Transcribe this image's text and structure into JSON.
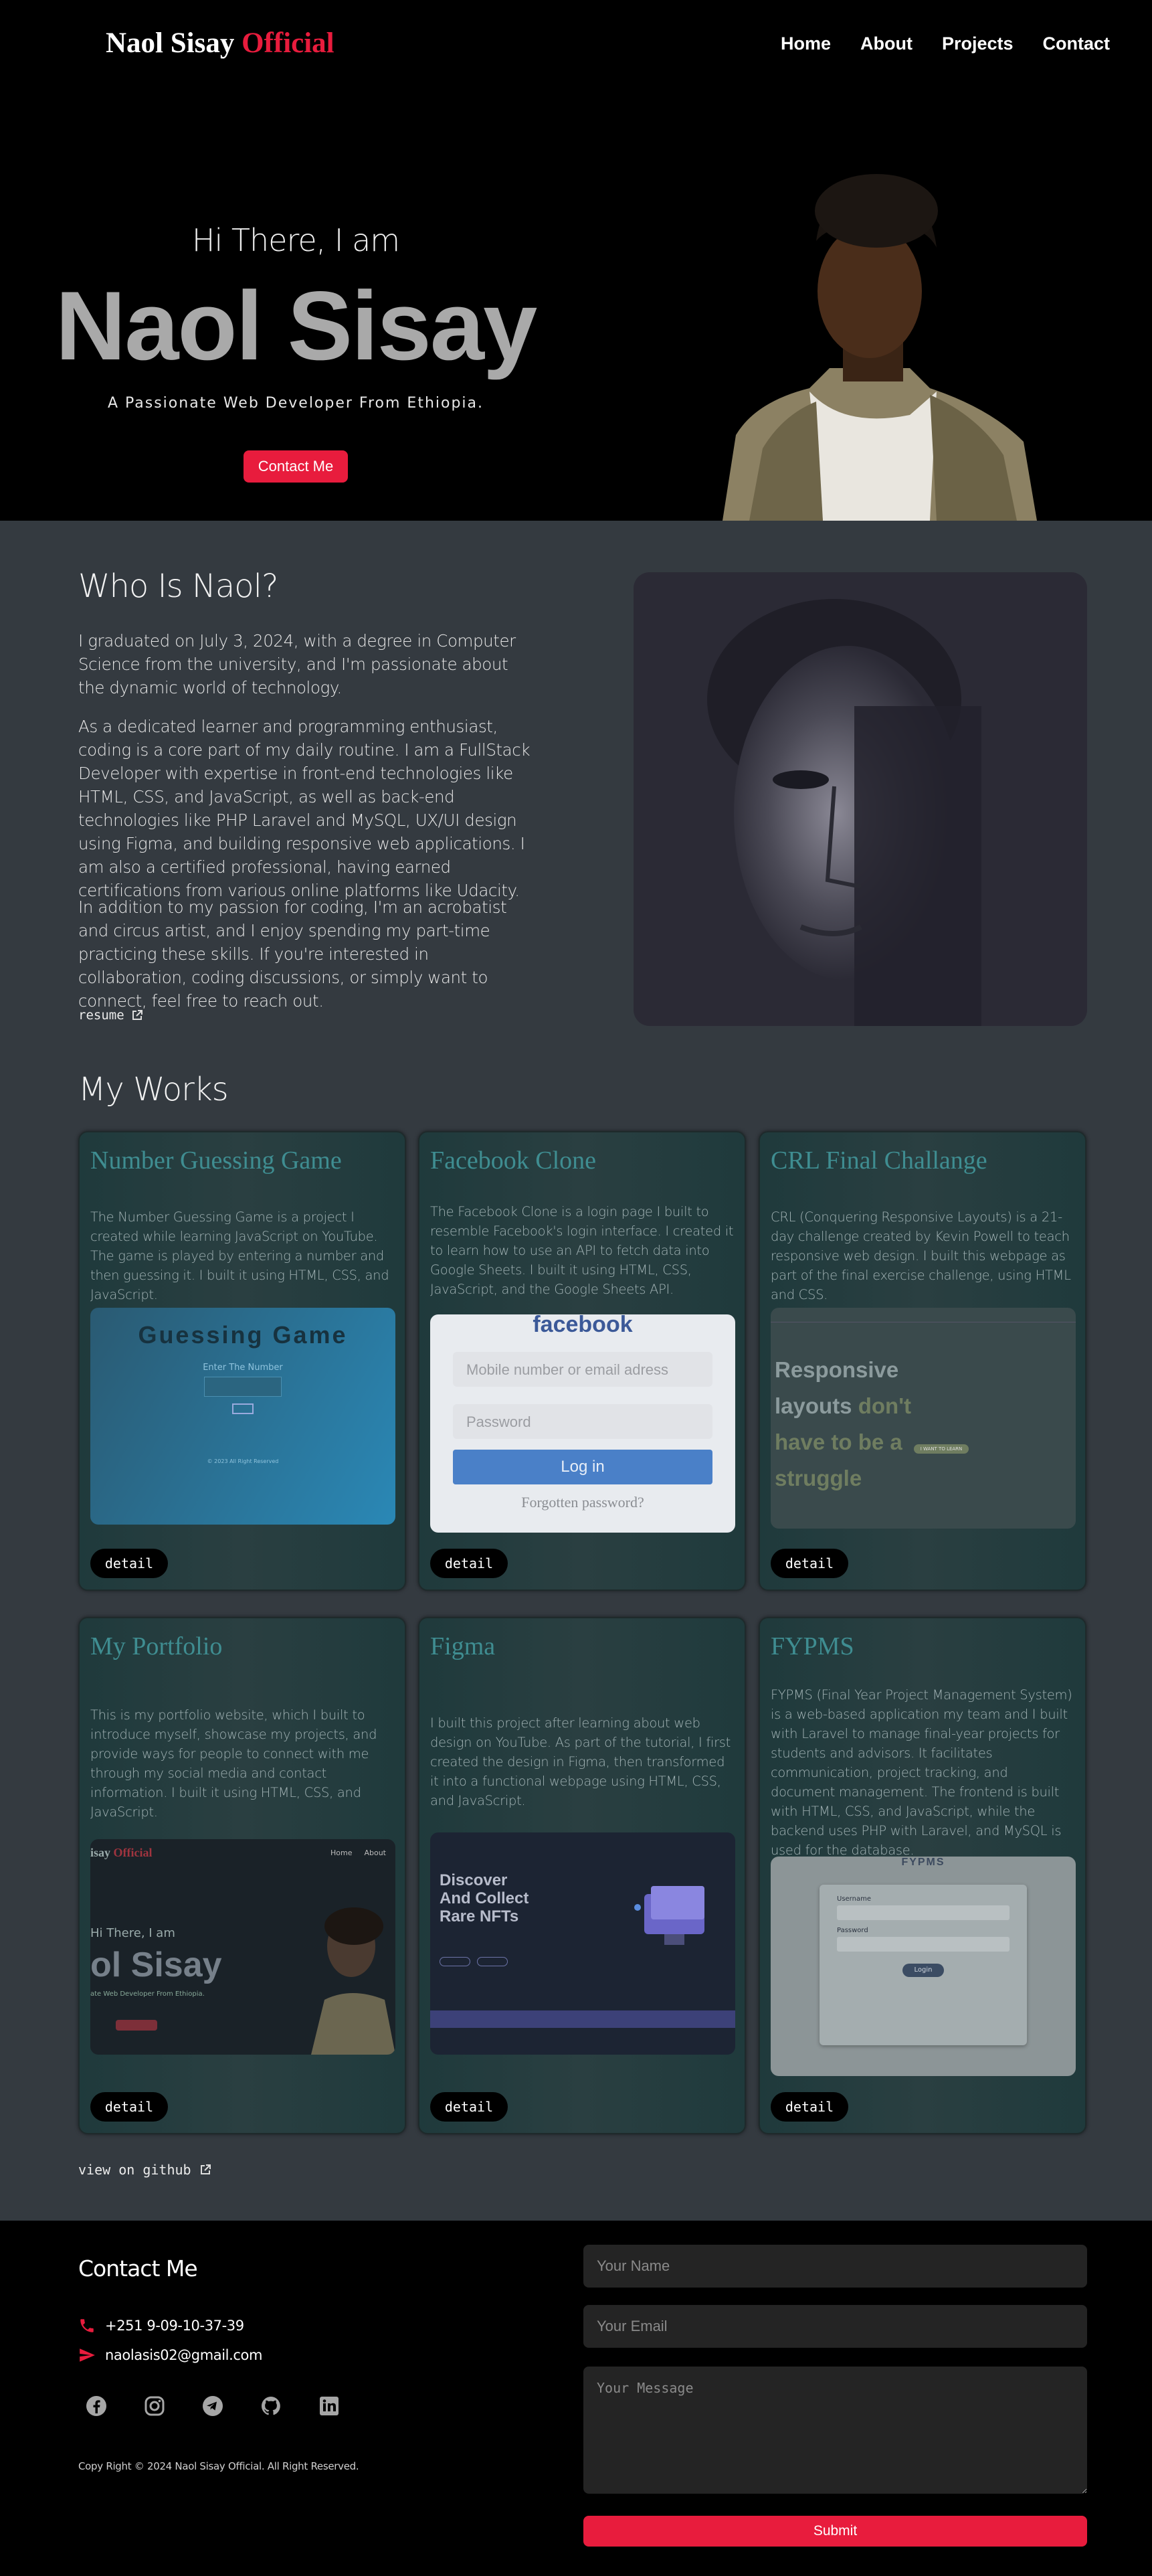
{
  "nav": {
    "logo_first": "Naol Sisay",
    "logo_second": "Official",
    "links": [
      "Home",
      "About",
      "Projects",
      "Contact"
    ]
  },
  "hero": {
    "greeting": "Hi There, I am",
    "name": "Naol Sisay",
    "subtitle": "A Passionate Web Developer From Ethiopia.",
    "button": "Contact Me"
  },
  "about": {
    "heading": "Who Is Naol?",
    "paragraphs": [
      "I graduated on July 3, 2024, with a degree in Computer Science from the university, and I'm passionate about the dynamic world of technology.",
      "As a dedicated learner and programming enthusiast, coding is a core part of my daily routine. I am a FullStack Developer with expertise in front-end technologies like HTML, CSS, and JavaScript, as well as back-end technologies like PHP Laravel and MySQL, UX/UI design using Figma, and building responsive web applications. I am also a certified professional, having earned certifications from various online platforms like Udacity.",
      "In addition to my passion for coding, I'm an acrobatist and circus artist, and I enjoy spending my part-time practicing these skills. If you're interested in collaboration, coding discussions, or simply want to connect, feel free to reach out."
    ],
    "resume_link": "resume"
  },
  "works": {
    "heading": "My Works",
    "detail_label": "detail",
    "github_link": "view on github",
    "projects": [
      {
        "title": "Number Guessing Game",
        "description": "The Number Guessing Game is a project I created while learning JavaScript on YouTube. The game is played by entering a number and then guessing it. I built it using HTML, CSS, and JavaScript.",
        "shot_title": "Guessing Game",
        "shot_label": "Enter The Number",
        "shot_footer": "© 2023 All Right Reserved"
      },
      {
        "title": "Facebook Clone",
        "description": "The Facebook Clone is a login page I built to resemble Facebook's login interface. I created it to learn how to use an API to fetch data into Google Sheets. I built it using HTML, CSS, JavaScript, and the Google Sheets API.",
        "shot_brand": "facebook",
        "shot_email": "Mobile number or email adress",
        "shot_password": "Password",
        "shot_login": "Log in",
        "shot_forgot": "Forgotten password?"
      },
      {
        "title": "CRL Final Challange",
        "description": "CRL (Conquering Responsive Layouts) is a 21-day challenge created by Kevin Powell to teach responsive web design. I built this webpage as part of the final exercise challenge, using HTML and CSS.",
        "shot_headline_a": "Responsive layouts",
        "shot_headline_b": "don't have to be a struggle",
        "shot_button": "I WANT TO LEARN"
      },
      {
        "title": "My Portfolio",
        "description": "This is my portfolio website, which I built to introduce myself, showcase my projects, and provide ways for people to connect with me through my social media and contact information. I built it using HTML, CSS, and JavaScript.",
        "shot_logo_a": "isay",
        "shot_logo_b": "Official",
        "shot_nav_a": "Home",
        "shot_nav_b": "About",
        "shot_greet": "Hi There, I am",
        "shot_name": "ol Sisay",
        "shot_sub": "ate Web Developer From Ethiopia."
      },
      {
        "title": "Figma",
        "description": "I built this project after learning about web design on YouTube. As part of the tutorial, I first created the design in Figma, then transformed it into a functional webpage using HTML, CSS, and JavaScript.",
        "shot_headline": "Discover And Collect Rare NFTs"
      },
      {
        "title": "FYPMS",
        "description": "FYPMS (Final Year Project Management System) is a web-based application my team and I built with Laravel to manage final-year projects for students and advisors. It facilitates communication, project tracking, and document management. The frontend is built with HTML, CSS, and JavaScript, while the backend uses PHP with Laravel, and MySQL is used for the database.",
        "shot_brand": "FYPMS",
        "shot_user": "Username",
        "shot_pass": "Password",
        "shot_login": "Login"
      }
    ]
  },
  "contact": {
    "heading": "Contact Me",
    "phone": "+251 9-09-10-37-39",
    "email": "naolasis02@gmail.com",
    "socials": [
      "facebook-icon",
      "instagram-icon",
      "telegram-icon",
      "github-icon",
      "linkedin-icon"
    ],
    "copyright": "Copy Right © 2024 Naol Sisay Official. All Right Reserved.",
    "name_placeholder": "Your Name",
    "email_placeholder": "Your Email",
    "message_placeholder": "Your Message",
    "submit": "Submit"
  },
  "colors": {
    "accent": "#e81c3d",
    "page_bg": "#343a40",
    "card_title": "#3f8d91"
  }
}
